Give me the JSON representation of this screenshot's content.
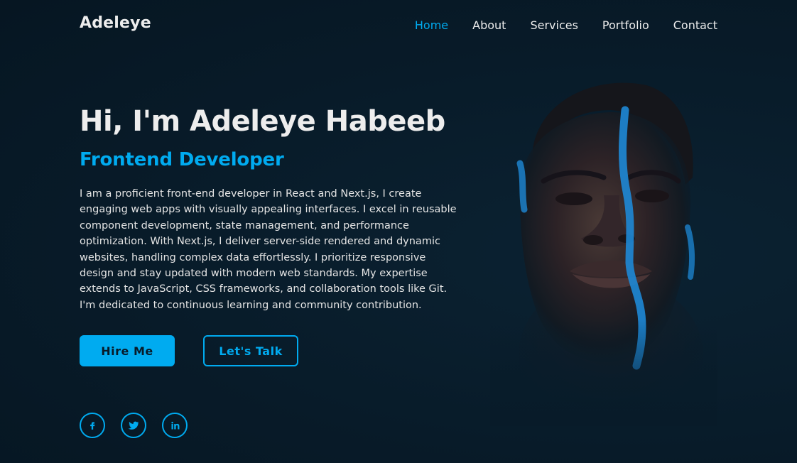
{
  "header": {
    "logo": "Adeleye",
    "nav": [
      {
        "label": "Home",
        "active": true
      },
      {
        "label": "About",
        "active": false
      },
      {
        "label": "Services",
        "active": false
      },
      {
        "label": "Portfolio",
        "active": false
      },
      {
        "label": "Contact",
        "active": false
      }
    ]
  },
  "hero": {
    "title": "Hi, I'm Adeleye Habeeb",
    "subtitle": "Frontend Developer",
    "description": "I am a proficient front-end developer in React and Next.js, I create engaging web apps with visually appealing interfaces. I excel in reusable component development, state management, and performance optimization. With Next.js, I deliver server-side rendered and dynamic websites, handling complex data effortlessly. I prioritize responsive design and stay updated with modern web standards. My expertise extends to JavaScript, CSS frameworks, and collaboration tools like Git. I'm dedicated to continuous learning and community contribution."
  },
  "buttons": {
    "hire": "Hire Me",
    "talk": "Let's Talk"
  },
  "social": [
    {
      "icon": "facebook-icon"
    },
    {
      "icon": "twitter-icon"
    },
    {
      "icon": "linkedin-icon"
    }
  ],
  "colors": {
    "background": "#081b29",
    "accent": "#00abf0",
    "text": "#ededed"
  }
}
